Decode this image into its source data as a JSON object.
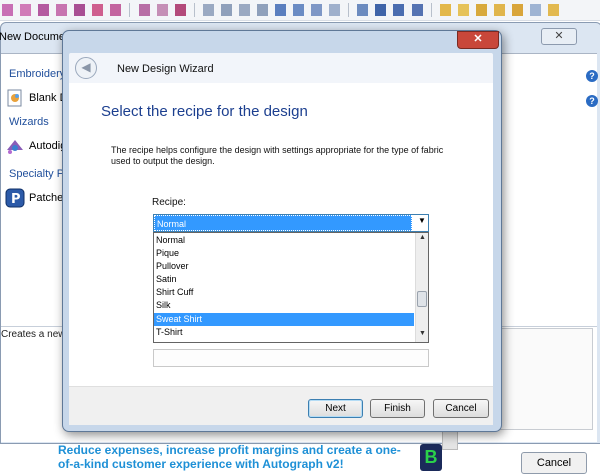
{
  "background_window": {
    "title": "New Document",
    "close_symbol": "✕",
    "categories": [
      "Embroidery",
      "Wizards",
      "Specialty Pr"
    ],
    "items": [
      "Blank D",
      "Autodig",
      "Patche"
    ],
    "description": "Creates a new d",
    "cancel_label": "Cancel",
    "help_symbol": "?"
  },
  "wizard": {
    "title": "New Design Wizard",
    "close_symbol": "✕",
    "back_symbol": "◀",
    "heading": "Select the recipe for the design",
    "description": "The recipe helps configure the design with settings appropriate for the type of fabric used to output the design.",
    "recipe_label": "Recipe:",
    "recipe_selected": "Normal",
    "recipe_options": [
      "Normal",
      "Pique",
      "Pullover",
      "Satin",
      "Shirt Cuff",
      "Silk",
      "Sweat Shirt",
      "T-Shirt"
    ],
    "highlighted_option": "Sweat Shirt",
    "buttons": {
      "next": "Next",
      "finish": "Finish",
      "cancel": "Cancel"
    }
  },
  "promo": {
    "text": "Reduce expenses, increase profit margins and create a one-of-a-kind customer experience with Autograph v2!",
    "logo_letter": "B"
  },
  "icons": [
    "toolbar-icon",
    "blank-design-icon",
    "autodigitize-icon",
    "patches-icon",
    "help-icon",
    "back-arrow-icon",
    "dropdown-arrow-icon"
  ],
  "colors": {
    "accent": "#3399ff",
    "heading": "#1c3f8f",
    "promo": "#1e90d6",
    "close": "#c9473a"
  }
}
